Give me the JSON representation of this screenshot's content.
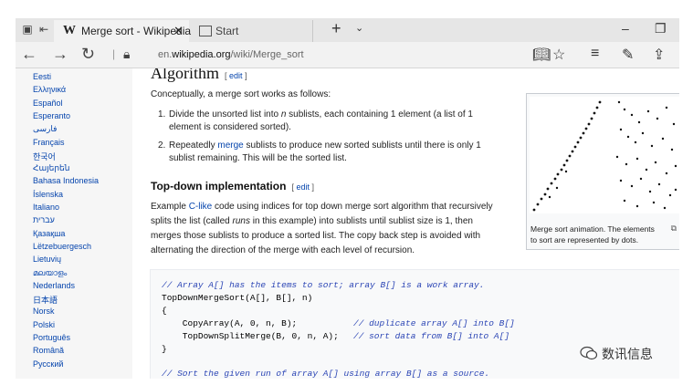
{
  "browser": {
    "active_tab": {
      "favicon": "W",
      "title": "Merge sort - Wikipedia"
    },
    "inactive_tab": {
      "title": "Start"
    },
    "url_prefix": "en.",
    "url_host": "wikipedia.org",
    "url_path": "/wiki/Merge_sort"
  },
  "sidebar": {
    "languages": [
      "Eesti",
      "Ελληνικά",
      "Español",
      "Esperanto",
      "فارسی",
      "Français",
      "한국어",
      "Հայերեն",
      "Bahasa Indonesia",
      "Íslenska",
      "Italiano",
      "עברית",
      "Қазақша",
      "Lëtzebuergesch",
      "Lietuvių",
      "മലയാളം",
      "Nederlands",
      "日本語",
      "Norsk",
      "Polski",
      "Português",
      "Română",
      "Русский"
    ]
  },
  "article": {
    "heading": "Algorithm",
    "edit_open": "[",
    "edit_label": "edit",
    "edit_close": "]",
    "intro": "Conceptually, a merge sort works as follows:",
    "steps": [
      {
        "num": "1.",
        "line1_a": "Divide the unsorted list into ",
        "line1_em": "n",
        "line1_b": " sublists, each containing 1 element (a list of 1",
        "line2": "element is considered sorted)."
      },
      {
        "num": "2.",
        "line1_a": "Repeatedly ",
        "line1_link": "merge",
        "line1_b": " sublists to produce new sorted sublists until there is only 1",
        "line2": "sublist remaining. This will be the sorted list."
      }
    ],
    "subheading": "Top-down implementation",
    "para": {
      "l1_a": "Example ",
      "l1_link": "C-like",
      "l1_b": " code using indices for top down merge sort algorithm that recursively",
      "l2_a": "splits the list (called ",
      "l2_em": "runs",
      "l2_b": " in this example) into sublists until sublist size is 1, then",
      "l3": "merges those sublists to produce a sorted list. The copy back step is avoided with",
      "l4": "alternating the direction of the merge with each level of recursion."
    },
    "figure_caption_1": "Merge sort animation. The elements",
    "figure_caption_2": "to sort are represented by dots.",
    "code": {
      "c1": "// Array A[] has the items to sort; array B[] is a work array.",
      "c2": "TopDownMergeSort(A[], B[], n)",
      "c3": "{",
      "c4_code": "    CopyArray(A, 0, n, B);",
      "c4_comment": "// duplicate array A[] into B[]",
      "c5_code": "    TopDownSplitMerge(B, 0, n, A);",
      "c5_comment": "// sort data from B[] into A[]",
      "c6": "}",
      "c7": "// Sort the given run of array A[] using array B[] as a source."
    }
  },
  "watermark": "数讯信息"
}
